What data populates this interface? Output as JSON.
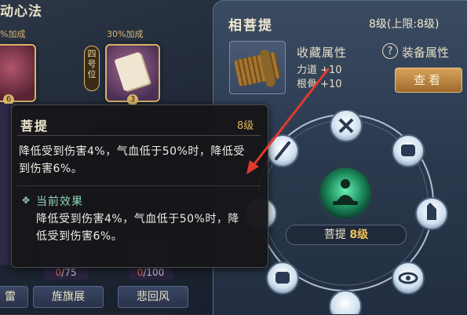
{
  "left": {
    "title": "动心法",
    "bonus_1": "%加成",
    "bonus_2": "30%加成",
    "position_badge": "四号位",
    "card_1_num": "6",
    "card_2_num": "3",
    "count_1_current": "0",
    "count_1_total": "/75",
    "count_2_current": "0",
    "count_2_total": "/100",
    "tabs": [
      "雷",
      "旌旗展",
      "悲回风"
    ]
  },
  "panel": {
    "title": "相菩提",
    "level": "8级(上限:8级)",
    "collect_title": "收藏属性",
    "attrs": [
      "力道 +10",
      "根骨 +10"
    ],
    "help_icon": "?",
    "equip_attr": "装备属性",
    "view_button": "查看",
    "center_name": "菩提",
    "center_level": "8级"
  },
  "tooltip": {
    "name": "菩提",
    "level": "8级",
    "description": "降低受到伤害4%，气血低于50%时，降低受到伤害6%。",
    "current_icon": "✥",
    "current_label": "当前效果",
    "current_text": "降低受到伤害4%，气血低于50%时，降低受到伤害6%。"
  },
  "icons": {
    "ring_node_icons": [
      "sword-icon",
      "knot-icon",
      "fist-icon",
      "hand-icon",
      "eye-icon",
      "fist-icon",
      "sword-icon"
    ],
    "center_icon": "meditating-figure-icon"
  },
  "colors": {
    "gold": "#f0c05a",
    "arrow": "#e03a2e",
    "current_effect": "#8fd4b6",
    "count_current": "#e0664f"
  }
}
